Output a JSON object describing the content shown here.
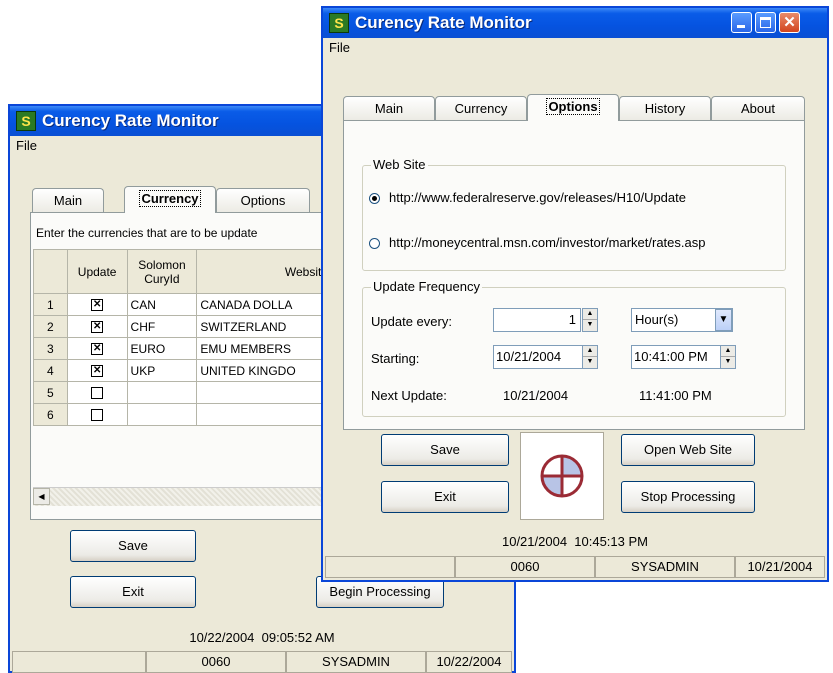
{
  "back_window": {
    "title": "Curency Rate Monitor",
    "menu_file": "File",
    "tabs": [
      "Main",
      "Currency",
      "Options"
    ],
    "active_tab": "Currency",
    "instruction": "Enter the currencies that are to be update",
    "table": {
      "headers": [
        "Update",
        "Solomon CuryId",
        "Website"
      ],
      "rows": [
        {
          "num": "1",
          "checked": true,
          "cury": "CAN",
          "website": "CANADA DOLLA"
        },
        {
          "num": "2",
          "checked": true,
          "cury": "CHF",
          "website": "SWITZERLAND"
        },
        {
          "num": "3",
          "checked": true,
          "cury": "EURO",
          "website": "EMU MEMBERS"
        },
        {
          "num": "4",
          "checked": true,
          "cury": "UKP",
          "website": "UNITED KINGDO"
        },
        {
          "num": "5",
          "checked": false,
          "cury": "",
          "website": ""
        },
        {
          "num": "6",
          "checked": false,
          "cury": "",
          "website": ""
        }
      ]
    },
    "save_label": "Save",
    "exit_label": "Exit",
    "begin_label": "Begin Processing",
    "datetime": "10/22/2004  09:05:52 AM",
    "status": [
      "",
      "0060",
      "SYSADMIN",
      "10/22/2004"
    ]
  },
  "front_window": {
    "title": "Curency Rate Monitor",
    "menu_file": "File",
    "tabs": [
      "Main",
      "Currency",
      "Options",
      "History",
      "About"
    ],
    "active_tab": "Options",
    "web_site": {
      "label": "Web Site",
      "option1": "http://www.federalreserve.gov/releases/H10/Update",
      "option2": "http://moneycentral.msn.com/investor/market/rates.asp",
      "selected": "option1"
    },
    "frequency": {
      "label": "Update Frequency",
      "update_every_label": "Update every:",
      "update_every_value": "1",
      "unit_value": "Hour(s)",
      "starting_label": "Starting:",
      "start_date": "10/21/2004",
      "start_time": "10:41:00 PM",
      "next_update_label": "Next Update:",
      "next_date": "10/21/2004",
      "next_time": "11:41:00 PM"
    },
    "save_label": "Save",
    "exit_label": "Exit",
    "open_label": "Open Web Site",
    "stop_label": "Stop Processing",
    "datetime": "10/21/2004  10:45:13 PM",
    "status": [
      "",
      "0060",
      "SYSADMIN",
      "10/21/2004"
    ]
  },
  "colors": {
    "title_blue": "#0553e0",
    "crosshair_red": "#9b2b35",
    "crosshair_fill": "#b8c4e6"
  }
}
